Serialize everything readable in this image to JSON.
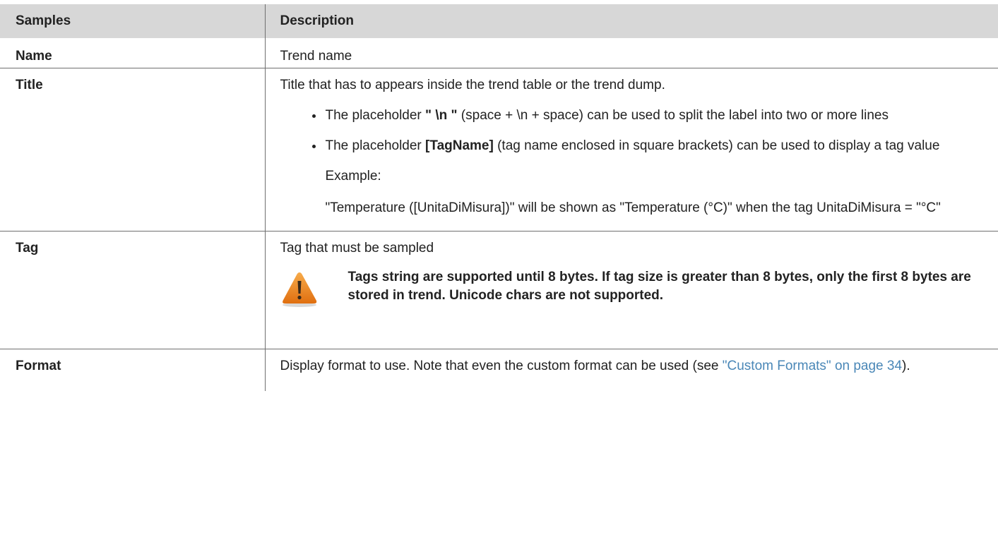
{
  "table": {
    "headers": {
      "samples": "Samples",
      "description": "Description"
    },
    "rows": {
      "name": {
        "label": "Name",
        "text": "Trend name"
      },
      "title": {
        "label": "Title",
        "intro": "Title that has to appears inside the trend table or the trend dump.",
        "bullet1": {
          "pre": "The placeholder ",
          "code": "\" \\n \"",
          "post": " (space + \\n + space) can be used to split the label into two or more lines"
        },
        "bullet2": {
          "pre": "The placeholder ",
          "code": "[TagName]",
          "post": " (tag name enclosed in square brackets) can be used to display a tag value"
        },
        "example_label": "Example:",
        "example_text": "\"Temperature ([UnitaDiMisura])\" will be shown as \"Temperature (°C)\" when the tag UnitaDiMisura = \"°C\""
      },
      "tag": {
        "label": "Tag",
        "text": "Tag that must be sampled",
        "warning": "Tags string are supported until 8 bytes. If tag size is greater than 8 bytes, only the first 8 bytes are stored in trend. Unicode chars are not supported.",
        "warning_icon": "warning-triangle-icon"
      },
      "format": {
        "label": "Format",
        "pre": "Display format to use. Note that even the custom format can be used (see ",
        "link": "\"Custom Formats\" on page 34",
        "post": ")."
      }
    }
  },
  "colors": {
    "header_bg": "#d7d7d7",
    "link": "#4a87b7",
    "warning_orange": "#f08a1c"
  }
}
